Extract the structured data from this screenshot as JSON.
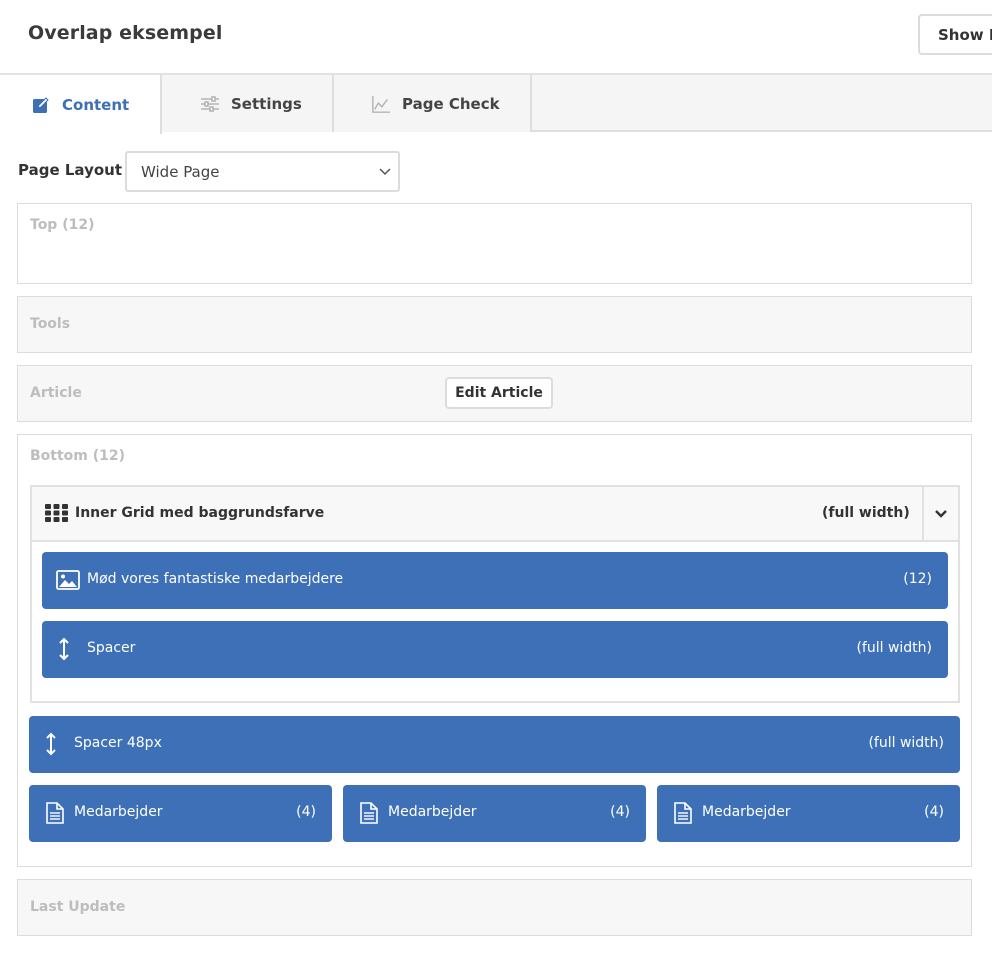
{
  "header": {
    "title": "Overlap eksempel",
    "show_button_label": "Show P"
  },
  "tabs": [
    {
      "label": "Content",
      "icon": "edit-icon",
      "active": true
    },
    {
      "label": "Settings",
      "icon": "sliders-icon",
      "active": false
    },
    {
      "label": "Page Check",
      "icon": "chart-icon",
      "active": false
    }
  ],
  "page_layout": {
    "label": "Page Layout",
    "selected": "Wide Page"
  },
  "zones": {
    "top": "Top (12)",
    "tools": "Tools",
    "article": "Article",
    "edit_article_label": "Edit Article",
    "bottom": "Bottom (12)",
    "last_update": "Last Update"
  },
  "inner_grid": {
    "title": "Inner Grid med baggrundsfarve",
    "width": "(full width)",
    "icon": "grid-icon",
    "blocks": [
      {
        "label": "Mød vores fantastiske medarbejdere",
        "size": "(12)",
        "icon": "image-icon"
      },
      {
        "label": "Spacer",
        "size": "(full width)",
        "icon": "resize-vertical-icon"
      }
    ]
  },
  "bottom_blocks": {
    "spacer": {
      "label": "Spacer 48px",
      "size": "(full width)",
      "icon": "resize-vertical-icon"
    },
    "staff": [
      {
        "label": "Medarbejder",
        "size": "(4)",
        "icon": "document-icon"
      },
      {
        "label": "Medarbejder",
        "size": "(4)",
        "icon": "document-icon"
      },
      {
        "label": "Medarbejder",
        "size": "(4)",
        "icon": "document-icon"
      }
    ]
  },
  "colors": {
    "accent": "#3d70b6",
    "tab_active_text": "#3f6fb5",
    "zone_label": "#bdbdbd"
  }
}
